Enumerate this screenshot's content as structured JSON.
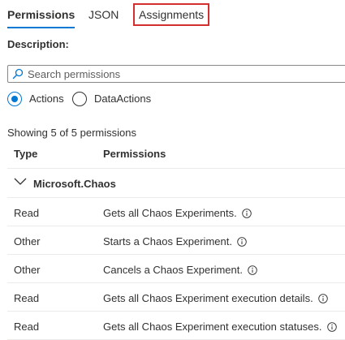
{
  "tabs": [
    {
      "label": "Permissions"
    },
    {
      "label": "JSON"
    },
    {
      "label": "Assignments"
    }
  ],
  "description_label": "Description",
  "description_suffix": ":",
  "search": {
    "placeholder": "Search permissions",
    "icon": "search-icon"
  },
  "radios": {
    "actions_label": "Actions",
    "dataactions_label": "DataActions",
    "selected": "Actions"
  },
  "showing_text": "Showing 5 of 5 permissions",
  "table": {
    "headers": {
      "type": "Type",
      "permissions": "Permissions"
    },
    "group": {
      "name": "Microsoft.Chaos",
      "icon": "chevron-down-icon"
    },
    "rows": [
      {
        "type": "Read",
        "permission": "Gets all Chaos Experiments."
      },
      {
        "type": "Other",
        "permission": "Starts a Chaos Experiment."
      },
      {
        "type": "Other",
        "permission": "Cancels a Chaos Experiment."
      },
      {
        "type": "Read",
        "permission": "Gets all Chaos Experiment execution details."
      },
      {
        "type": "Read",
        "permission": "Gets all Chaos Experiment execution statuses."
      }
    ]
  },
  "colors": {
    "accent": "#0078d4",
    "highlight_border": "#d32f2f",
    "text": "#323130"
  }
}
